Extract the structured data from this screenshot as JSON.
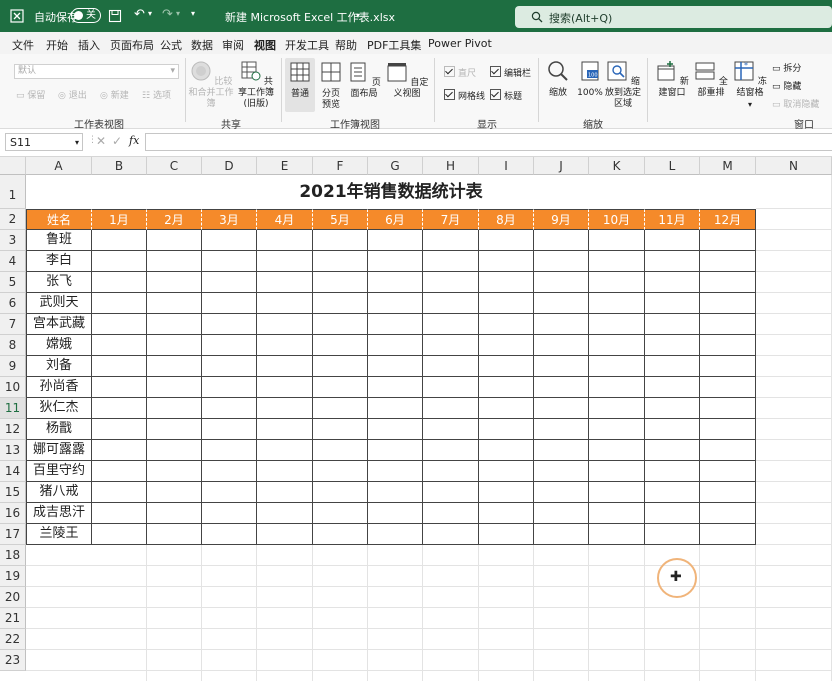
{
  "titlebar": {
    "autosave_label": "自动保存",
    "autosave_state": "关",
    "filename": "新建 Microsoft Excel 工作表.xlsx",
    "search_placeholder": "搜索(Alt+Q)",
    "bg_color": "#1e6e41"
  },
  "menu": [
    "文件",
    "开始",
    "插入",
    "页面布局",
    "公式",
    "数据",
    "审阅",
    "视图",
    "开发工具",
    "帮助",
    "PDF工具集",
    "Power Pivot"
  ],
  "menu_active": "视图",
  "ribbon": {
    "sheet_view": {
      "dropdown_value": "默认",
      "items": [
        "保留",
        "退出",
        "新建",
        "选项"
      ],
      "group": "工作表视图"
    },
    "share": {
      "compare": "比较和合并工作簿",
      "shared": "共享工作簿(旧版)",
      "group": "共享"
    },
    "workbook_views": {
      "items": [
        "普通",
        "分页预览",
        "页面布局",
        "自定义视图"
      ],
      "group": "工作簿视图"
    },
    "show": {
      "ruler": "直尺",
      "formula_bar": "编辑栏",
      "gridlines": "网格线",
      "headings": "标题",
      "group": "显示"
    },
    "zoom": {
      "items": [
        "缩放",
        "100%",
        "缩放到选定区域"
      ],
      "icon_text": "100",
      "group": "缩放"
    },
    "window": {
      "new_window": "新建窗口",
      "arrange_all": "全部重排",
      "freeze": "冻结窗格",
      "split": "拆分",
      "hide": "隐藏",
      "unhide": "取消隐藏",
      "group": "窗口"
    }
  },
  "formula_bar": {
    "name_box": "S11",
    "fx": "fx",
    "content": ""
  },
  "grid": {
    "columns": [
      "A",
      "B",
      "C",
      "D",
      "E",
      "F",
      "G",
      "H",
      "I",
      "J",
      "K",
      "L",
      "M",
      "N"
    ],
    "rows": [
      "1",
      "2",
      "3",
      "4",
      "5",
      "6",
      "7",
      "8",
      "9",
      "10",
      "11",
      "12",
      "13",
      "14",
      "15",
      "16",
      "17",
      "18",
      "19",
      "20",
      "21",
      "22",
      "23"
    ],
    "title": "2021年销售数据统计表",
    "header": [
      "姓名",
      "1月",
      "2月",
      "3月",
      "4月",
      "5月",
      "6月",
      "7月",
      "8月",
      "9月",
      "10月",
      "11月",
      "12月"
    ],
    "names": [
      "鲁班",
      "李白",
      "张飞",
      "武则天",
      "宫本武藏",
      "嫦娥",
      "刘备",
      "孙尚香",
      "狄仁杰",
      "杨戬",
      "娜可露露",
      "百里守约",
      "猪八戒",
      "成吉思汗",
      "兰陵王"
    ],
    "header_color": "#f58a2a"
  }
}
